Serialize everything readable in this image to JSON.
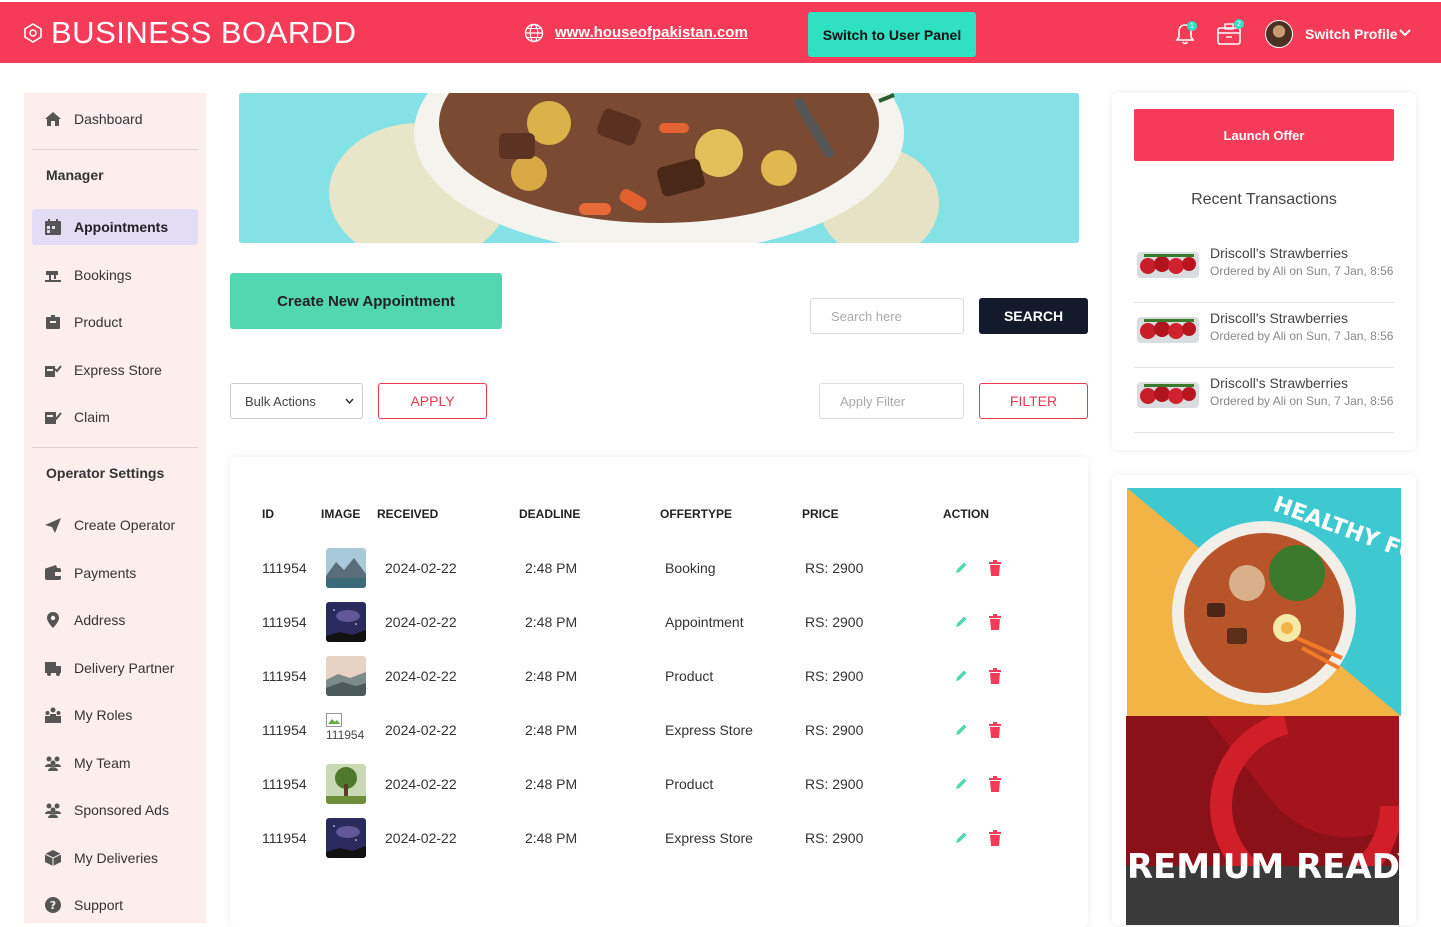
{
  "header": {
    "brand": "BUSINESS BOARDD",
    "site_link": "www.houseofpakistan.com",
    "switch_button": "Switch to User Panel",
    "notifications_count": "1",
    "messages_count": "2",
    "profile_label": "Switch Profile"
  },
  "sidebar": {
    "dashboard": "Dashboard",
    "manager_heading": "Manager",
    "manager_items": [
      "Appointments",
      "Bookings",
      "Product",
      "Express Store",
      "Claim"
    ],
    "operator_heading": "Operator Settings",
    "operator_items": [
      "Create Operator",
      "Payments",
      "Address",
      "Delivery Partner",
      "My Roles",
      "My Team",
      "Sponsored Ads",
      "My Deliveries",
      "Support"
    ]
  },
  "main": {
    "create_button": "Create New Appointment",
    "search_placeholder": "Search here",
    "search_button": "SEARCH",
    "bulk_actions": "Bulk Actions",
    "apply_button": "APPLY",
    "filter_placeholder": "Apply Filter",
    "filter_button": "FILTER"
  },
  "table": {
    "headers": [
      "ID",
      "IMAGE",
      "RECEIVED",
      "DEADLINE",
      "OFFERTYPE",
      "PRICE",
      "ACTION"
    ],
    "rows": [
      {
        "id": "111954",
        "received": "2024-02-22",
        "deadline": "2:48 PM",
        "offertype": "Booking",
        "price": "RS: 2900"
      },
      {
        "id": "111954",
        "received": "2024-02-22",
        "deadline": "2:48 PM",
        "offertype": "Appointment",
        "price": "RS: 2900"
      },
      {
        "id": "111954",
        "received": "2024-02-22",
        "deadline": "2:48 PM",
        "offertype": "Product",
        "price": "RS: 2900"
      },
      {
        "id": "111954",
        "image_alt": "111954",
        "received": "2024-02-22",
        "deadline": "2:48 PM",
        "offertype": "Express Store",
        "price": "RS: 2900"
      },
      {
        "id": "111954",
        "received": "2024-02-22",
        "deadline": "2:48 PM",
        "offertype": "Product",
        "price": "RS: 2900"
      },
      {
        "id": "111954",
        "received": "2024-02-22",
        "deadline": "2:48 PM",
        "offertype": "Express Store",
        "price": "RS: 2900"
      }
    ]
  },
  "right": {
    "launch_button": "Launch Offer",
    "recent_title": "Recent Transactions",
    "transactions": [
      {
        "name": "Driscoll's Strawberries",
        "sub": "Ordered by Ali on Sun, 7 Jan, 8:56"
      },
      {
        "name": "Driscoll's Strawberries",
        "sub": "Ordered by Ali on Sun, 7 Jan, 8:56"
      },
      {
        "name": "Driscoll's Strawberries",
        "sub": "Ordered by Ali on Sun, 7 Jan, 8:56"
      }
    ],
    "ad_healthy_text": "HEALTHY FOOD",
    "ad_premium_text": "PREMIUM READY"
  },
  "colors": {
    "brand_red": "#f53b57",
    "accent_teal": "#2fe0c2",
    "create_green": "#52d7b0",
    "dark_button": "#121a2b"
  }
}
